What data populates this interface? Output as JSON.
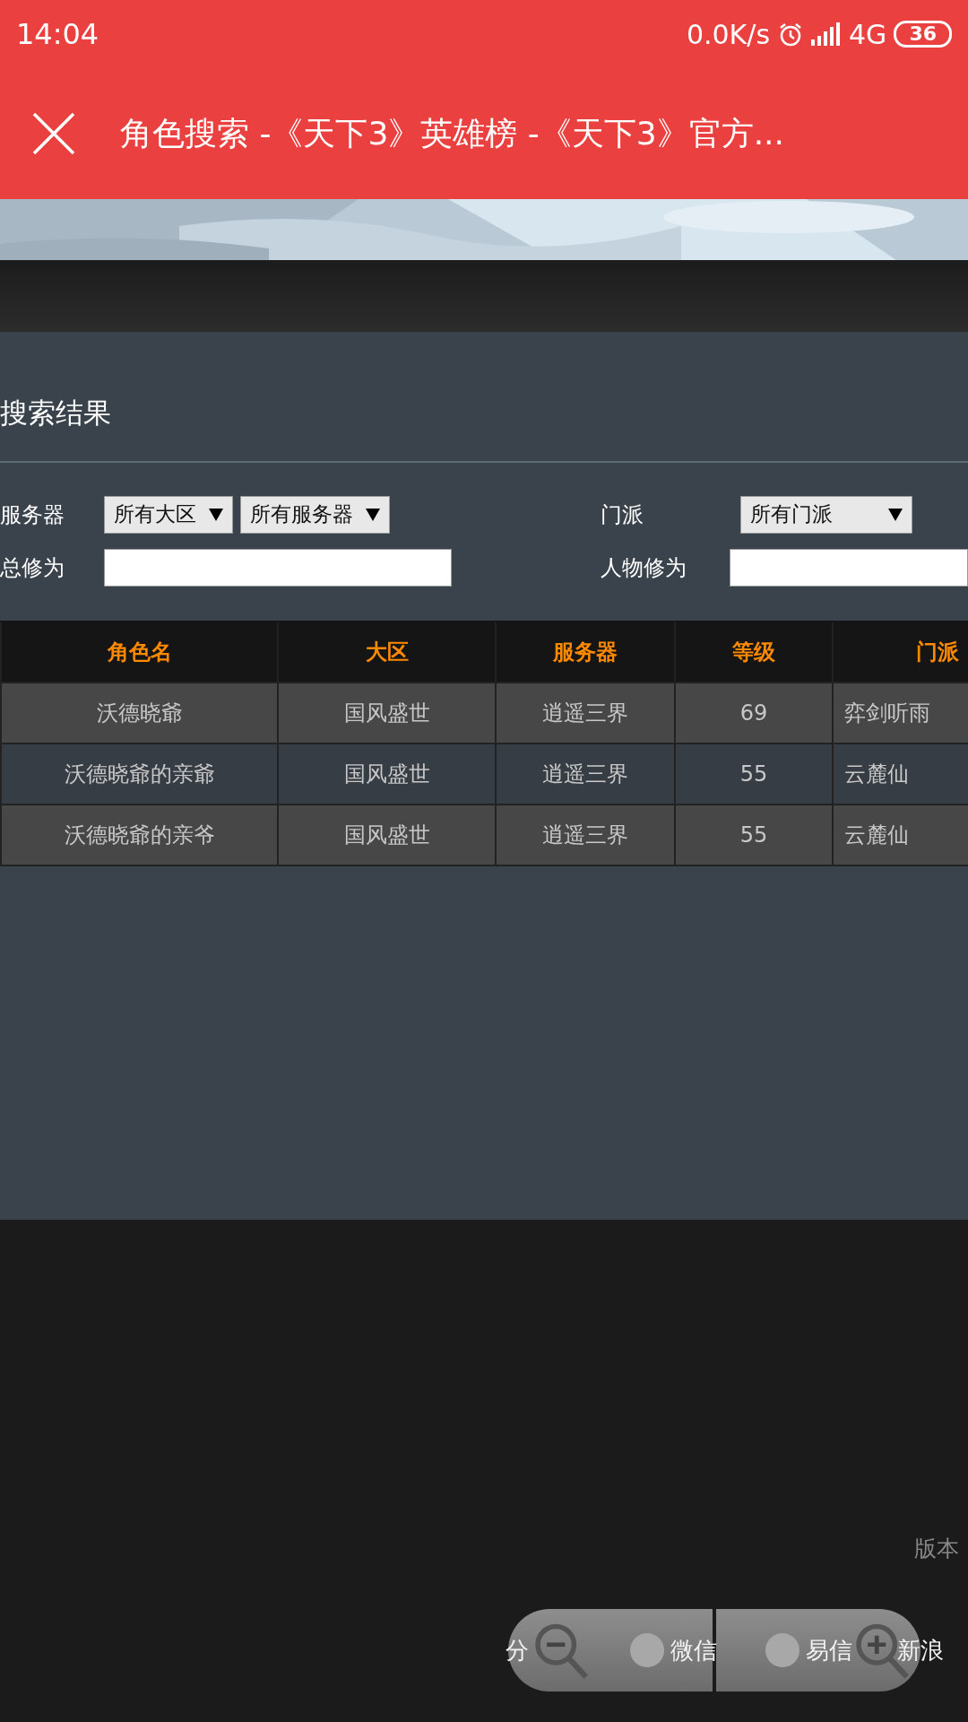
{
  "status_bar": {
    "time": "14:04",
    "speed": "0.0K/s",
    "network": "4G",
    "battery": "36"
  },
  "title_bar": {
    "title": "角色搜索 -《天下3》英雄榜 -《天下3》官方..."
  },
  "heading": "搜索结果",
  "filters": [
    {
      "label": "服务器",
      "kind": "selects",
      "selects": [
        "所有大区",
        "所有服务器"
      ]
    },
    {
      "label": "门派",
      "kind": "selects",
      "selects": [
        "所有门派"
      ]
    },
    {
      "label": "总修为",
      "kind": "input"
    },
    {
      "label": "人物修为",
      "kind": "input"
    }
  ],
  "table": {
    "columns": [
      "角色名",
      "大区",
      "服务器",
      "等级",
      "门派"
    ],
    "rows": [
      [
        "沃德晓爺",
        "国风盛世",
        "逍遥三界",
        "69",
        "弈剑听雨"
      ],
      [
        "沃德晓爺的亲爺",
        "国风盛世",
        "逍遥三界",
        "55",
        "云麓仙"
      ],
      [
        "沃德晓爺的亲爷",
        "国风盛世",
        "逍遥三界",
        "55",
        "云麓仙"
      ]
    ]
  },
  "footer": {
    "version": "版本",
    "share_label": "分",
    "share_targets": [
      "微信",
      "易信",
      "新浪"
    ]
  }
}
